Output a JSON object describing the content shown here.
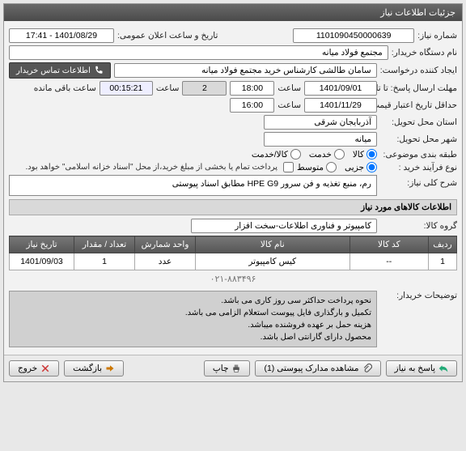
{
  "header": {
    "title": "جزئیات اطلاعات نیاز"
  },
  "fields": {
    "need_no_lbl": "شماره نیاز:",
    "need_no": "1101090450000639",
    "pub_date_lbl": "تاریخ و ساعت اعلان عمومی:",
    "pub_date": "1401/08/29 - 17:41",
    "buyer_org_lbl": "نام دستگاه خریدار:",
    "buyer_org": "مجتمع فولاد میانه",
    "requester_lbl": "ایجاد کننده درخواست:",
    "requester": "سامان طالشی کارشناس خرید مجتمع فولاد میانه",
    "contact_btn": "اطلاعات تماس خریدار",
    "deadline_lbl": "مهلت ارسال پاسخ: تا تاریخ:",
    "deadline_date": "1401/09/01",
    "time_lbl": "ساعت",
    "deadline_time": "18:00",
    "days_remaining": "2",
    "countdown": "00:15:21",
    "remaining_lbl": "ساعت باقی مانده",
    "validity_lbl": "حداقل تاریخ اعتبار قیمت: تا تاریخ:",
    "validity_date": "1401/11/29",
    "validity_time": "16:00",
    "province_lbl": "استان محل تحویل:",
    "province": "آذربایجان شرقی",
    "city_lbl": "شهر محل تحویل:",
    "city": "میانه",
    "category_lbl": "طبقه بندی موضوعی:",
    "cat_goods": "کالا",
    "cat_service": "خدمت",
    "cat_goods_service": "کالا/خدمت",
    "process_lbl": "نوع فرآیند خرید :",
    "proc_partial": "جزیی",
    "proc_medium": "متوسط",
    "process_note": "پرداخت تمام یا بخشی از مبلغ خرید،از محل \"اسناد خزانه اسلامی\" خواهد بود.",
    "need_desc_lbl": "شرح کلی نیاز:",
    "need_desc": "رم، منبع تغذیه و فن سرور HPE G9 مطابق اسناد پیوستی",
    "items_hd": "اطلاعات کالاهای مورد نیاز",
    "group_lbl": "گروه کالا:",
    "group": "کامپیوتر و فناوری اطلاعات-سخت افزار",
    "buyer_notes_lbl": "توضیحات خریدار:",
    "buyer_notes": [
      "نحوه پرداخت حداکثر سی روز کاری می باشد.",
      "تکمیل و بارگذاری فایل پیوست استعلام الزامی می باشد.",
      "هزینه حمل بر عهده فروشنده میباشد.",
      "محصول دارای گارانتی اصل باشد."
    ]
  },
  "table": {
    "cols": [
      "ردیف",
      "کد کالا",
      "نام کالا",
      "واحد شمارش",
      "تعداد / مقدار",
      "تاریخ نیاز"
    ],
    "rows": [
      {
        "c": [
          "1",
          "--",
          "کیس کامپیوتر",
          "عدد",
          "1",
          "1401/09/03"
        ]
      }
    ]
  },
  "phone_partial": "۰۲۱-۸۸۳۴۹۶",
  "footer": {
    "reply": "پاسخ به نیاز",
    "attach": "مشاهده مدارک پیوستی (1)",
    "print": "چاپ",
    "back": "بازگشت",
    "exit": "خروج"
  }
}
